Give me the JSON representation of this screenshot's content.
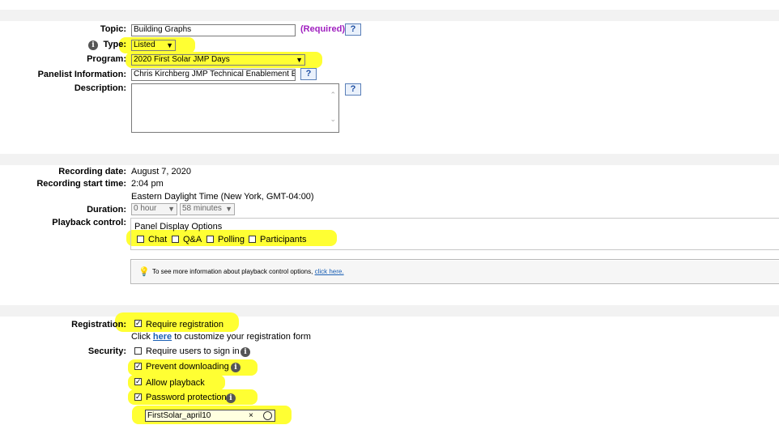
{
  "colors": {
    "highlight": "#ffff33",
    "required": "#a020c0",
    "link": "#1a5fb4"
  },
  "general": {
    "topic_label": "Topic:",
    "topic_value": "Building Graphs",
    "required_text": "(Required)",
    "help_glyph": "?",
    "type_label": "Type:",
    "type_value": "Listed",
    "program_label": "Program:",
    "program_value": "2020 First Solar JMP Days",
    "panelist_label": "Panelist Information:",
    "panelist_value": "Chris Kirchberg JMP Technical Enablement E",
    "description_label": "Description:"
  },
  "recording": {
    "date_label": "Recording date:",
    "date_value": "August 7, 2020",
    "start_label": "Recording start time:",
    "start_value": "2:04 pm",
    "timezone": "Eastern Daylight Time (New York, GMT-04:00)",
    "duration_label": "Duration:",
    "hours_value": "0 hour",
    "minutes_value": "58 minutes",
    "playback_label": "Playback control:",
    "panel_options_title": "Panel Display Options",
    "options": [
      "Chat",
      "Q&A",
      "Polling",
      "Participants"
    ],
    "tip_text": "To see more information about playback control options,",
    "tip_link": "click here."
  },
  "registration": {
    "registration_label": "Registration:",
    "require_registration": "Require registration",
    "click_text": "Click",
    "here_link": "here",
    "customize_text": "to customize your registration form",
    "security_label": "Security:",
    "require_sign_in": "Require users to sign in",
    "prevent_downloading": "Prevent downloading",
    "allow_playback": "Allow playback",
    "password_protection": "Password protection",
    "password_value": "FirstSolar_april10",
    "clear_glyph": "×"
  }
}
